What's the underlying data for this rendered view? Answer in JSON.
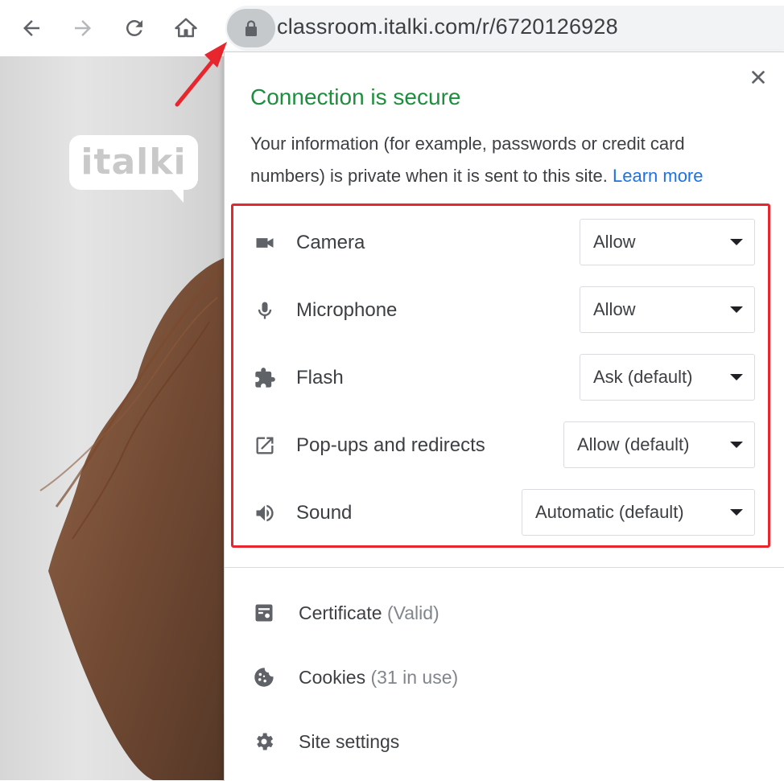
{
  "browser": {
    "url": "classroom.italki.com/r/6720126928",
    "icons": {
      "back": "arrow-left-icon",
      "forward": "arrow-right-icon",
      "reload": "reload-icon",
      "home": "home-icon",
      "lock": "lock-icon"
    }
  },
  "page": {
    "logo_text": "italki"
  },
  "popup": {
    "title": "Connection is secure",
    "description": "Your information (for example, passwords or credit card numbers) is private when it is sent to this site.",
    "learn_more": "Learn more",
    "close_icon": "close-icon",
    "permissions": [
      {
        "label": "Camera",
        "value": "Allow",
        "icon": "camera-icon"
      },
      {
        "label": "Microphone",
        "value": "Allow",
        "icon": "microphone-icon"
      },
      {
        "label": "Flash",
        "value": "Ask (default)",
        "icon": "puzzle-icon"
      },
      {
        "label": "Pop-ups and redirects",
        "value": "Allow (default)",
        "icon": "external-link-icon"
      },
      {
        "label": "Sound",
        "value": "Automatic (default)",
        "icon": "speaker-icon"
      }
    ],
    "info_items": [
      {
        "label": "Certificate",
        "detail": "(Valid)",
        "icon": "certificate-icon"
      },
      {
        "label": "Cookies",
        "detail": "(31 in use)",
        "icon": "cookie-icon"
      },
      {
        "label": "Site settings",
        "detail": "",
        "icon": "gear-icon"
      }
    ]
  },
  "colors": {
    "secure_green": "#1e8e3e",
    "link_blue": "#1a73e8",
    "highlight_red": "#e8262d"
  }
}
